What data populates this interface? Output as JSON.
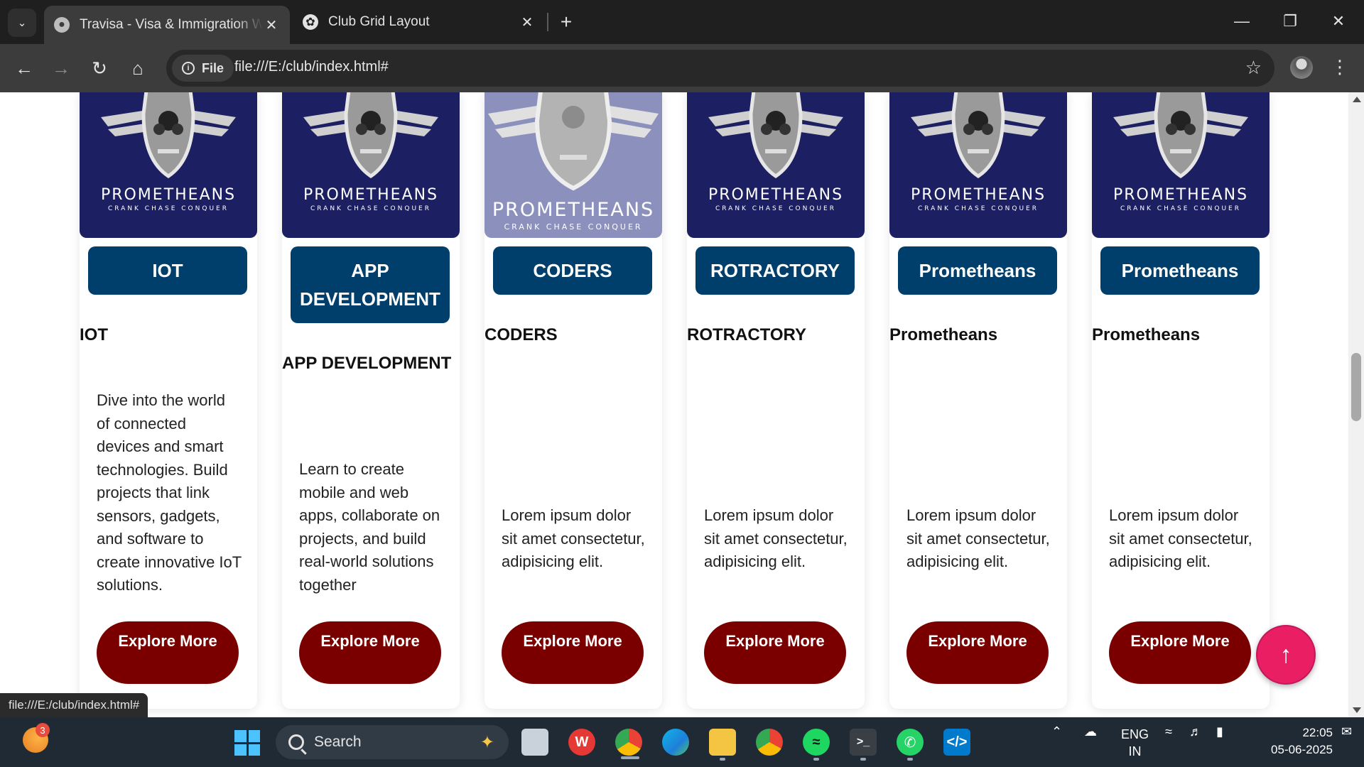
{
  "browser": {
    "tabs": [
      {
        "title": "Travisa - Visa & Immigration W",
        "active": true
      },
      {
        "title": "Club Grid Layout",
        "active": false
      }
    ],
    "address": {
      "chip_label": "File",
      "url": "file:///E:/club/index.html#"
    },
    "status_url": "file:///E:/club/index.html#"
  },
  "cards": [
    {
      "pill": "IOT",
      "heading": "IOT",
      "description": "Dive into the world of connected devices and smart technologies. Build projects that link sensors, gadgets, and software to create innovative IoT solutions.",
      "button": "Explore More"
    },
    {
      "pill": "APP DEVELOPMENT",
      "heading": "APP DEVELOPMENT",
      "description": "Learn to create mobile and web apps, collaborate on projects, and build real-world solutions together",
      "button": "Explore More"
    },
    {
      "pill": "CODERS",
      "heading": "CODERS",
      "description": "Lorem ipsum dolor sit amet consectetur, adipisicing elit.",
      "button": "Explore More"
    },
    {
      "pill": "ROTRACTORY",
      "heading": "ROTRACTORY",
      "description": "Lorem ipsum dolor sit amet consectetur, adipisicing elit.",
      "button": "Explore More"
    },
    {
      "pill": "Prometheans",
      "heading": "Prometheans",
      "description": "Lorem ipsum dolor sit amet consectetur, adipisicing elit.",
      "button": "Explore More"
    },
    {
      "pill": "Prometheans",
      "heading": "Prometheans",
      "description": "Lorem ipsum dolor sit amet consectetur, adipisicing elit.",
      "button": "Explore More"
    }
  ],
  "logo": {
    "name": "PROMETHEANS",
    "tagline": "CRANK CHASE CONQUER"
  },
  "taskbar": {
    "search_placeholder": "Search",
    "weather_badge": "3",
    "language": {
      "line1": "ENG",
      "line2": "IN"
    },
    "time": "22:05",
    "date": "05-06-2025"
  },
  "colors": {
    "pill": "#003e6b",
    "explore_button": "#7a0000",
    "logo_bg": "#1c1f61",
    "back_to_top": "#e91e63"
  }
}
